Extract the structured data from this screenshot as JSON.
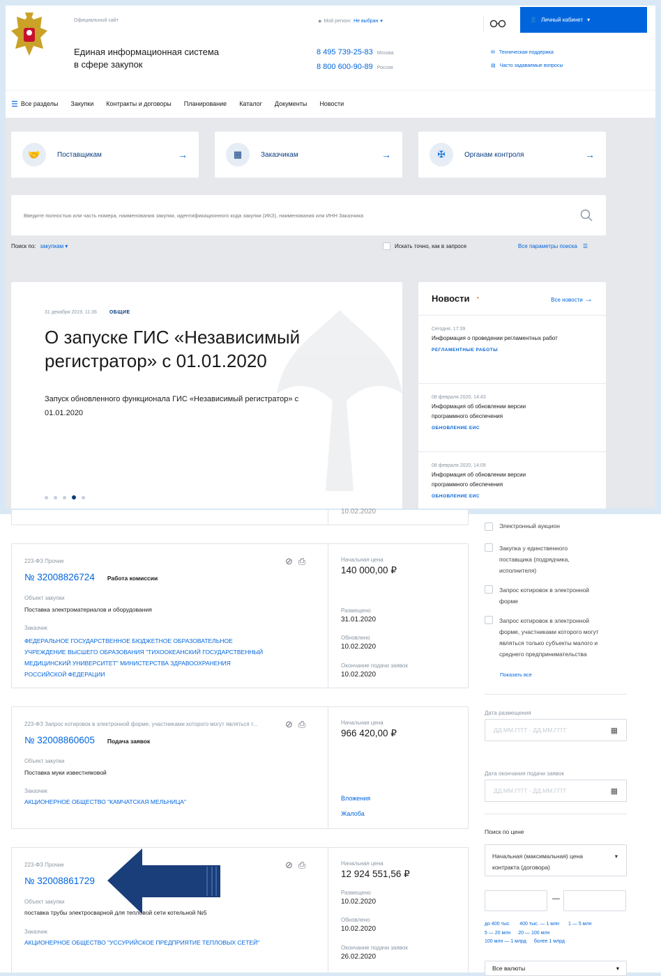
{
  "header": {
    "official": "Официальный сайт",
    "title_line1": "Единая информационная система",
    "title_line2": "в сфере закупок",
    "region_label": "Мой регион:",
    "region_value": "Не выбран",
    "phone1": "8 495 739-25-83",
    "phone1_city": "Москва",
    "phone2": "8 800 600-90-89",
    "phone2_city": "Россия",
    "cabinet": "Личный кабинет",
    "support": "Техническая поддержка",
    "faq": "Часто задаваемые вопросы"
  },
  "nav": [
    "Все разделы",
    "Закупки",
    "Контракты и договоры",
    "Планирование",
    "Каталог",
    "Документы",
    "Новости"
  ],
  "tiles": [
    "Поставщикам",
    "Заказчикам",
    "Органам контроля"
  ],
  "search": {
    "placeholder": "Введите полностью или часть номера, наименования закупки, идентификационного кода закупки (ИКЗ), наименования или ИНН Заказчика",
    "by_label": "Поиск по:",
    "by_value": "закупкам",
    "exact": "Искать точно, как в запросе",
    "all_params": "Все параметры поиска"
  },
  "banner": {
    "date": "31 декабря 2019, 11:36",
    "tag": "ОБЩИЕ",
    "title_line1": "О запуске ГИС «Независимый",
    "title_line2": "регистратор» с 01.01.2020",
    "text_line1": "Запуск обновленного функционала ГИС «Независимый регистратор» с",
    "text_line2": "01.01.2020"
  },
  "news": {
    "title": "Новости",
    "all": "Все новости",
    "items": [
      {
        "date": "Сегодня, 17:39",
        "l1": "Информация о проведении регламентных работ",
        "l2": "",
        "tag": "РЕГЛАМЕНТНЫЕ РАБОТЫ"
      },
      {
        "date": "08 февраля 2020, 14:43",
        "l1": "Информация об обновлении версии",
        "l2": "программного обеспечения",
        "tag": "ОБНОВЛЕНИЕ ЕИС"
      },
      {
        "date": "08 февраля 2020, 14:09",
        "l1": "Информация об обновлении версии",
        "l2": "программного обеспечения",
        "tag": "ОБНОВЛЕНИЕ ЕИС"
      }
    ]
  },
  "prev_date": "10.02.2020",
  "results": [
    {
      "law": "223-ФЗ Прочие",
      "number": "№ 32008826724",
      "status": "Работа комиссии",
      "object_label": "Объект закупки",
      "object": "Поставка электроматериалов и оборудования",
      "customer_label": "Заказчик",
      "customer_l1": "ФЕДЕРАЛЬНОЕ ГОСУДАРСТВЕННОЕ БЮДЖЕТНОЕ ОБРАЗОВАТЕЛЬНОЕ",
      "customer_l2": "УЧРЕЖДЕНИЕ ВЫСШЕГО ОБРАЗОВАНИЯ \"ТИХООКЕАНСКИЙ ГОСУДАРСТВЕННЫЙ",
      "customer_l3": "МЕДИЦИНСКИЙ УНИВЕРСИТЕТ\" МИНИСТЕРСТВА ЗДРАВООХРАНЕНИЯ",
      "customer_l4": "РОССИЙСКОЙ ФЕДЕРАЦИИ",
      "price_label": "Начальная цена",
      "price": "140 000,00 ₽",
      "posted_label": "Размещено",
      "posted": "31.01.2020",
      "updated_label": "Обновлено",
      "updated": "10.02.2020",
      "end_label": "Окончание подачи заявок",
      "end": "10.02.2020"
    },
    {
      "law": "223-ФЗ Запрос котировок в электронной форме, участниками которого могут являться т...",
      "number": "№ 32008860605",
      "status": "Подача заявок",
      "object_label": "Объект закупки",
      "object": "Поставка муки известняковой",
      "customer_label": "Заказчик",
      "customer_l1": "АКЦИОНЕРНОЕ ОБЩЕСТВО \"КАМЧАТСКАЯ МЕЛЬНИЦА\"",
      "price_label": "Начальная цена",
      "price": "966 420,00 ₽",
      "attachments": "Вложения",
      "complaint": "Жалоба"
    },
    {
      "law": "223-ФЗ Прочие",
      "number": "№ 32008861729",
      "object_label": "Объект закупки",
      "object": "поставка трубы электросварной для тепловой сети котельной №5",
      "customer_label": "Заказчик",
      "customer_l1": "АКЦИОНЕРНОЕ ОБЩЕСТВО \"УССУРИЙСКОЕ ПРЕДПРИЯТИЕ ТЕПЛОВЫХ СЕТЕЙ\"",
      "price_label": "Начальная цена",
      "price": "12 924 551,56 ₽",
      "posted_label": "Размещено",
      "posted": "10.02.2020",
      "updated_label": "Обновлено",
      "updated": "10.02.2020",
      "end_label": "Окончание подачи заявок",
      "end": "26.02.2020"
    }
  ],
  "filters": {
    "methods": [
      {
        "l1": "Электронный аукцион",
        "l2": "",
        "l3": "",
        "l4": ""
      },
      {
        "l1": "Закупка у единственного",
        "l2": "поставщика (подрядчика,",
        "l3": "исполнителя)",
        "l4": ""
      },
      {
        "l1": "Запрос котировок в электронной",
        "l2": "форме",
        "l3": "",
        "l4": ""
      },
      {
        "l1": "Запрос котировок в электронной",
        "l2": "форме, участниками которого могут",
        "l3": "являться только субъекты малого и",
        "l4": "среднего предпринимательства"
      }
    ],
    "show_all": "Показать все",
    "date_posted_label": "Дата размещения",
    "date_end_label": "Дата окончания подачи заявок",
    "date_placeholder": "ДД.ММ.ГГГГ - ДД.ММ.ГГГГ",
    "price_search": "Поиск по цене",
    "price_type_l1": "Начальная (максимальная) цена",
    "price_type_l2": "контракта (договора)",
    "ranges_row1": [
      "до 400 тыс.",
      "400 тыс. — 1 млн",
      "1 — 5 млн"
    ],
    "ranges_row2": [
      "5 — 20 млн",
      "20 — 100 млн"
    ],
    "ranges_row3": [
      "100 млн — 1 млрд",
      "более 1 млрд"
    ],
    "currency": "Все валюты"
  },
  "colors": {
    "accent": "#0065dd",
    "arrow": "#1a3e7a"
  }
}
